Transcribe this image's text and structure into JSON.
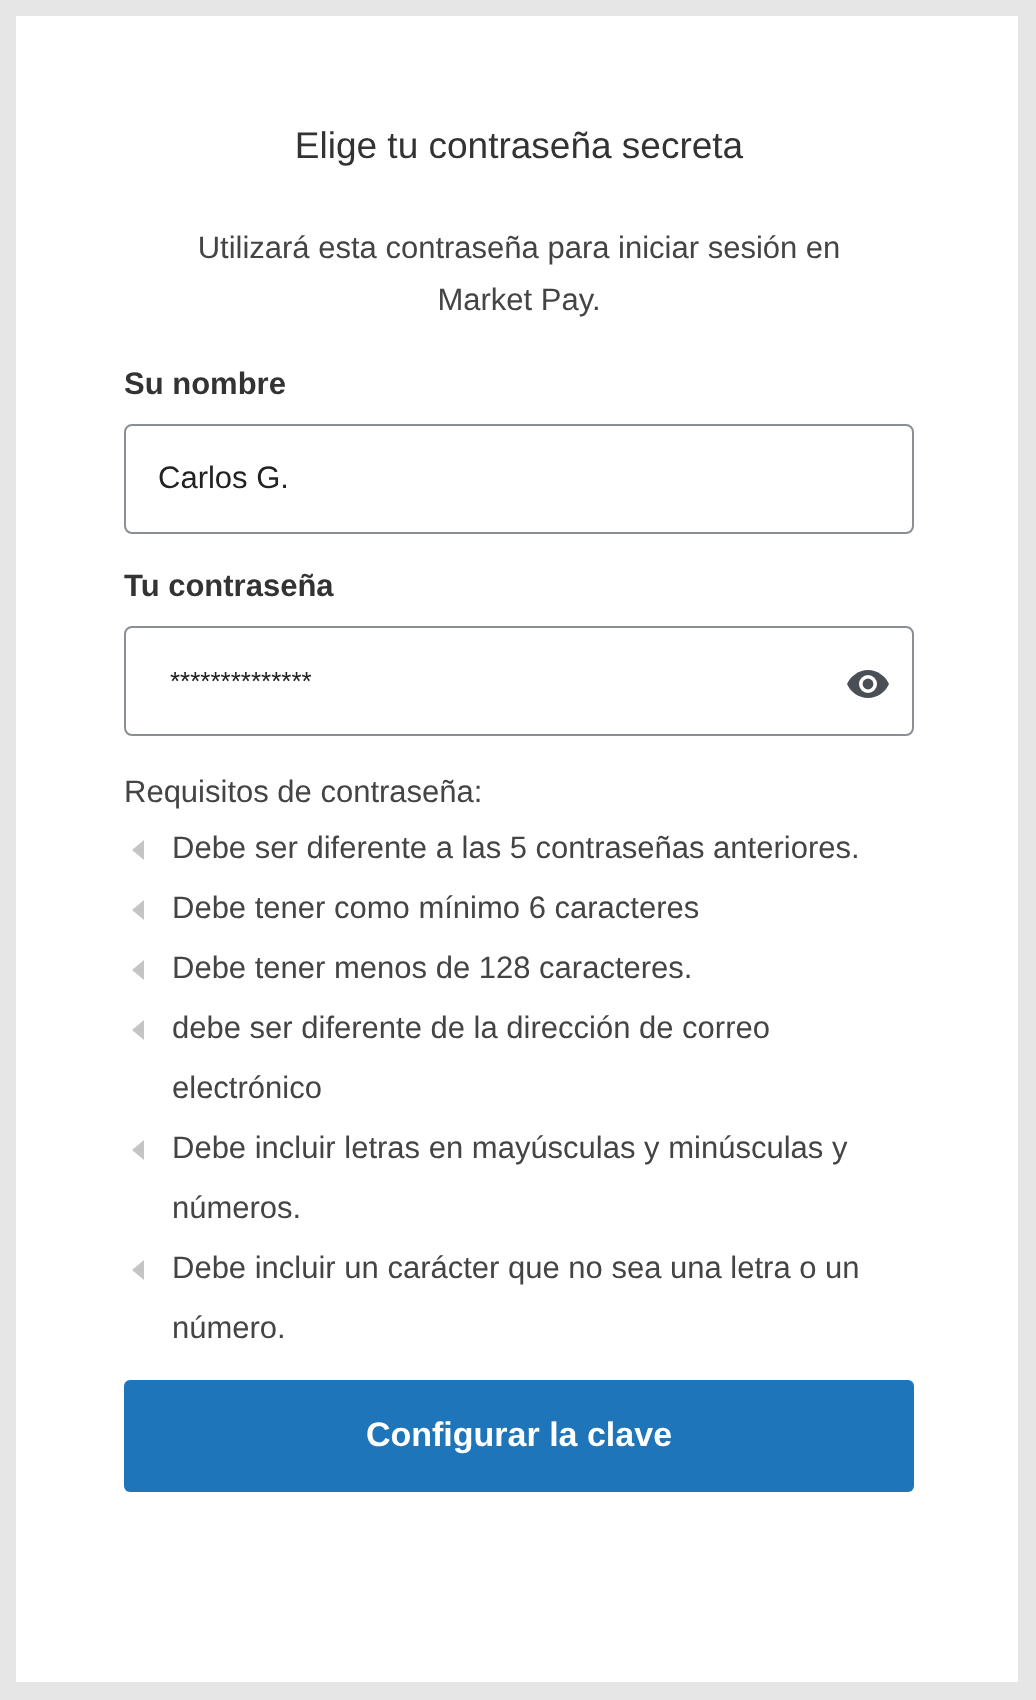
{
  "title": "Elige tu contraseña secreta",
  "subtitle": "Utilizará esta contraseña para iniciar sesión en Market Pay.",
  "name_field": {
    "label": "Su nombre",
    "value": "Carlos G."
  },
  "password_field": {
    "label": "Tu contraseña",
    "value": "**************"
  },
  "requirements": {
    "heading": "Requisitos de contraseña:",
    "items": [
      {
        "text": "Debe ser diferente a las 5 contraseñas anteriores."
      },
      {
        "text": "Debe tener como mínimo 6 caracteres"
      },
      {
        "text": "Debe tener menos de 128 caracteres."
      },
      {
        "text": "debe ser diferente de la dirección de correo electrónico"
      },
      {
        "text": "Debe incluir letras en mayúsculas y minúsculas y números."
      },
      {
        "text": "Debe incluir un carácter que no sea una letra o un número."
      }
    ]
  },
  "submit_button": "Configurar la clave"
}
